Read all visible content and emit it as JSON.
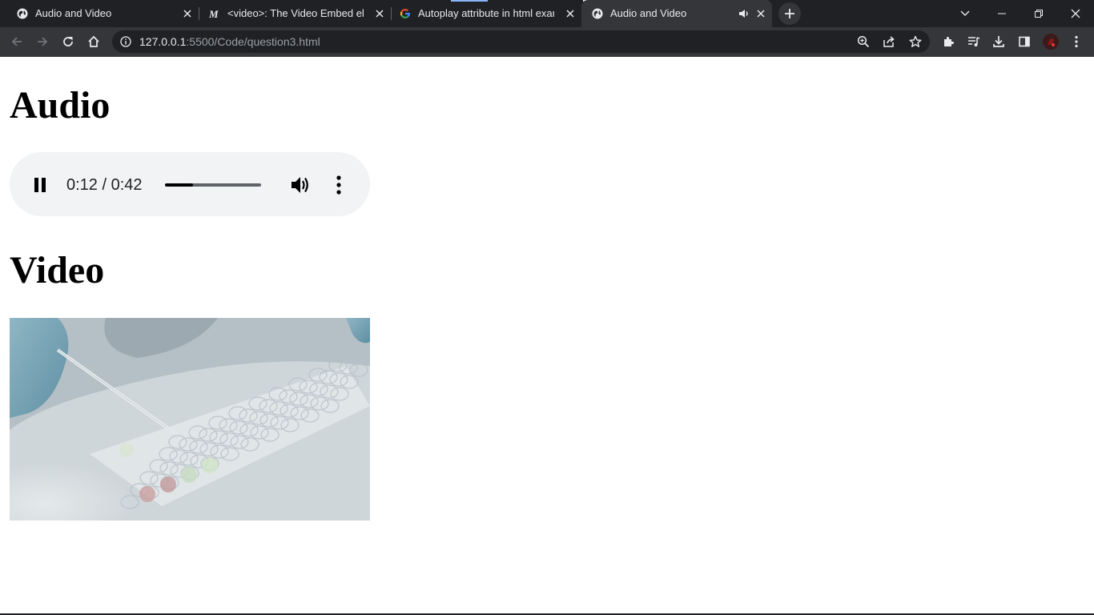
{
  "browser": {
    "tabs": [
      {
        "title": "Audio and Video",
        "favicon": "globe-icon",
        "active": false
      },
      {
        "title": "<video>: The Video Embed element",
        "favicon": "mdn-icon",
        "active": false
      },
      {
        "title": "Autoplay attribute in html example",
        "favicon": "google-icon",
        "active": false
      },
      {
        "title": "Audio and Video",
        "favicon": "globe-icon",
        "active": true,
        "playing_audio": true
      }
    ],
    "address_bar": {
      "host": "127.0.0.1",
      "rest": ":5500/Code/question3.html"
    }
  },
  "page": {
    "audio_heading": "Audio",
    "video_heading": "Video",
    "audio_player": {
      "time": "0:12 / 0:42",
      "progress": 0.29,
      "state": "playing"
    },
    "video": {
      "description_icon": "lab-pipette-well-plate-frame"
    }
  },
  "colors": {
    "tab_strip": "#202124",
    "toolbar": "#35363a",
    "omnibox": "#202124",
    "player_bg": "#f1f3f4"
  }
}
